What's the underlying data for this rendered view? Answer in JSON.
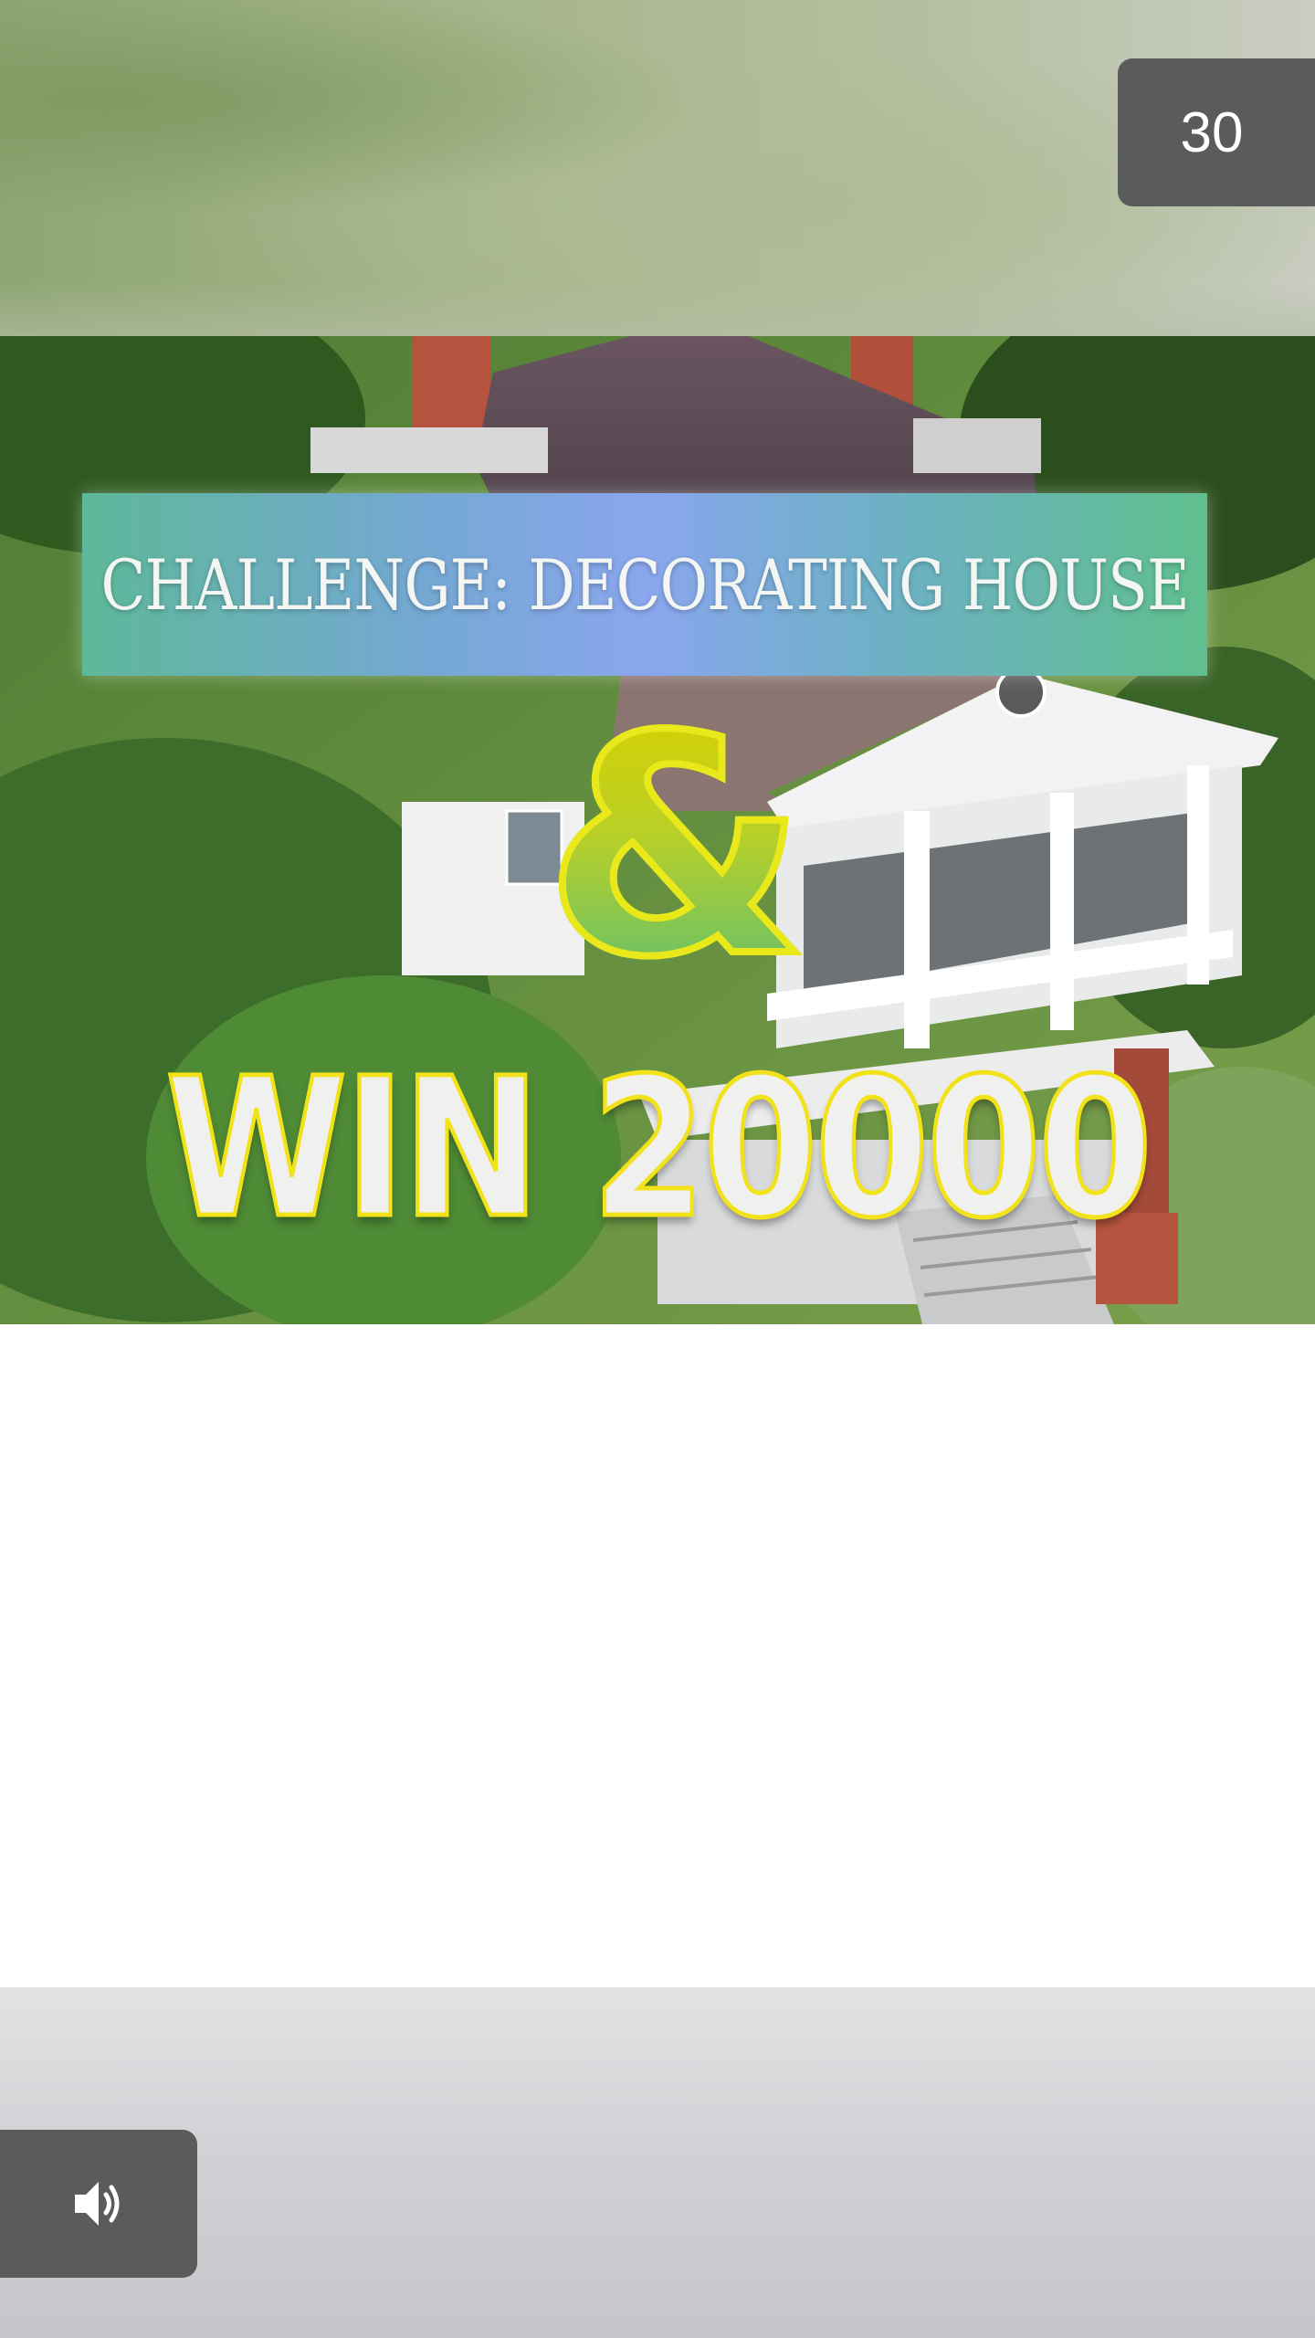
{
  "timer": {
    "label": "30"
  },
  "video": {
    "banner_text": "CHALLENGE:   DECORATING HOUSE",
    "ampersand": "&",
    "headline": "WIN 20000"
  },
  "controls": {
    "sound_icon": "speaker-volume-icon"
  },
  "colors": {
    "timer_bg": "#5b5b5b",
    "headline_outline": "#f2e21a",
    "banner_gradient": [
      "#5eb89a",
      "#8aa6ee",
      "#5fbf8e"
    ]
  }
}
